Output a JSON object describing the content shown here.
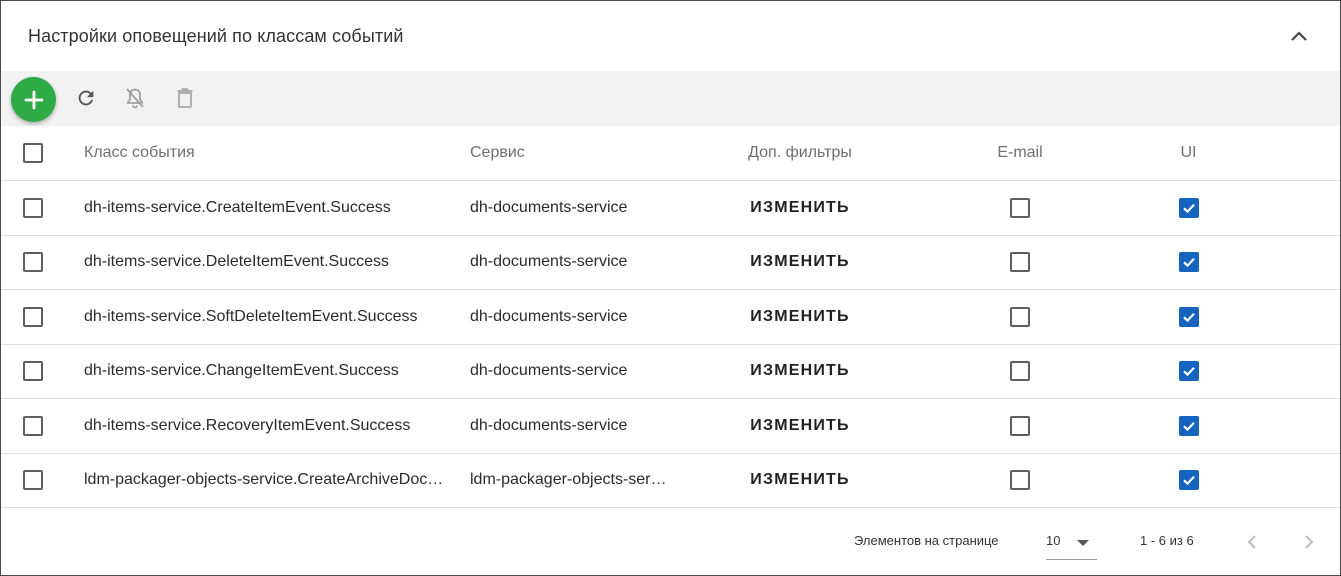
{
  "panel": {
    "title": "Настройки оповещений по классам событий"
  },
  "toolbar": {
    "add_icon": "plus-icon",
    "refresh_icon": "refresh-icon",
    "bell_off_icon": "bell-off-icon",
    "trash_icon": "trash-icon"
  },
  "table": {
    "headers": {
      "event_class": "Класс события",
      "service": "Сервис",
      "filters": "Доп. фильтры",
      "email": "E-mail",
      "ui": "UI"
    },
    "edit_label": "ИЗМЕНИТЬ",
    "rows": [
      {
        "event_class": "dh-items-service.CreateItemEvent.Success",
        "service": "dh-documents-service",
        "email": false,
        "ui": true
      },
      {
        "event_class": "dh-items-service.DeleteItemEvent.Success",
        "service": "dh-documents-service",
        "email": false,
        "ui": true
      },
      {
        "event_class": "dh-items-service.SoftDeleteItemEvent.Success",
        "service": "dh-documents-service",
        "email": false,
        "ui": true
      },
      {
        "event_class": "dh-items-service.ChangeItemEvent.Success",
        "service": "dh-documents-service",
        "email": false,
        "ui": true
      },
      {
        "event_class": "dh-items-service.RecoveryItemEvent.Success",
        "service": "dh-documents-service",
        "email": false,
        "ui": true
      },
      {
        "event_class": "ldm-packager-objects-service.CreateArchiveDoc…",
        "service": "ldm-packager-objects-ser…",
        "email": false,
        "ui": true
      }
    ]
  },
  "paginator": {
    "items_per_page_label": "Элементов на странице",
    "page_size": "10",
    "range_label": "1 - 6 из 6"
  },
  "colors": {
    "accent": "#2eaa47",
    "checkbox_checked": "#1565c0",
    "toolbar_bg": "#f2f2f2"
  }
}
